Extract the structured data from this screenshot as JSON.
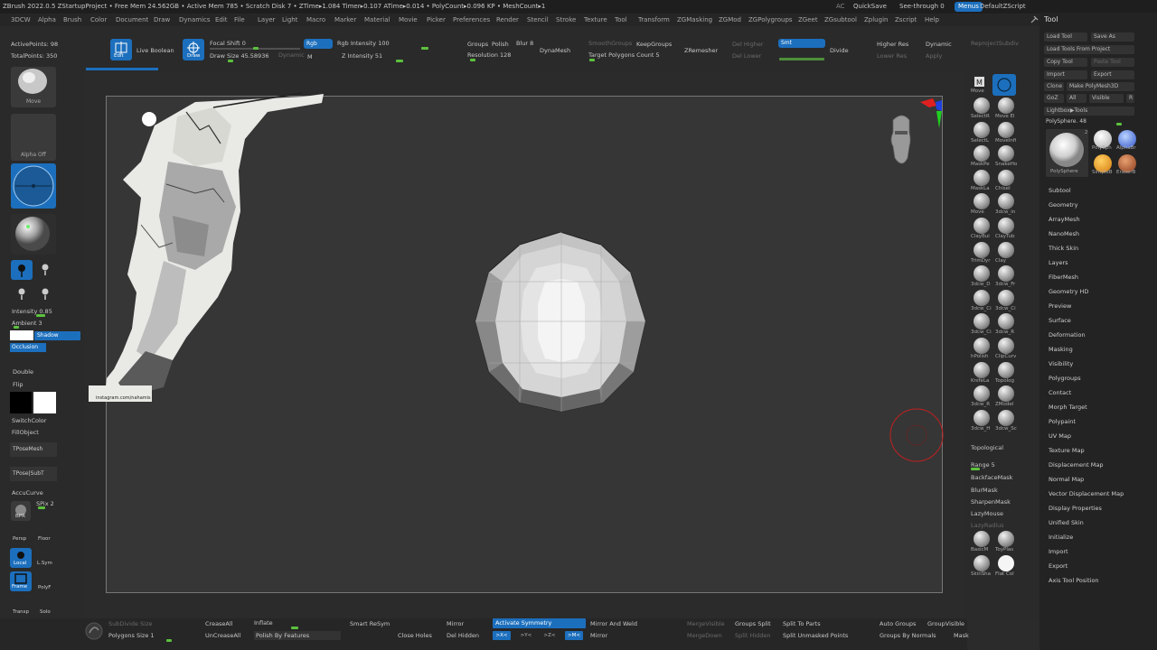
{
  "titlebar": {
    "text": "ZBrush 2022.0.5   ZStartupProject   • Free Mem 24.562GB • Active Mem 785 • Scratch Disk 7 • ZTime▸1.084 Timer▸0.107 ATime▸0.014 • PolyCount▸0.096 KP • MeshCount▸1",
    "ac": "AC",
    "quicksave": "QuickSave",
    "see_through": "See-through  0",
    "menus": "Menus",
    "default_script": "DefaultZScript"
  },
  "menubar": [
    "3DCW",
    "Alpha",
    "Brush",
    "Color",
    "Document",
    "Draw",
    "Dynamics",
    "Edit",
    "File",
    "Layer",
    "Light",
    "Macro",
    "Marker",
    "Material",
    "Movie",
    "Picker",
    "Preferences",
    "Render",
    "Stencil",
    "Stroke",
    "Texture",
    "Tool",
    "Transform",
    "ZGMasking",
    "ZGMod",
    "ZGPolygroups",
    "ZGeet",
    "ZGsubtool",
    "Zplugin",
    "Zscript",
    "Help"
  ],
  "topshelf": {
    "active_points": "ActivePoints: 98",
    "total_points": "TotalPoints: 350",
    "edit": "Edit",
    "live_boolean": "Live Boolean",
    "draw": "Draw",
    "focal_shift": "Focal Shift 0",
    "draw_size": "Draw Size 45.58936",
    "dynamic": "Dynamic",
    "rgb": "Rgb",
    "m": "M",
    "rgb_intensity": "Rgb Intensity 100",
    "z_intensity": "Z Intensity 51",
    "groups": "Groups",
    "polish": "Polish",
    "blur": "Blur 8",
    "resolution": "Resolution 128",
    "dynamesh": "DynaMesh",
    "smooth_groups": "SmoothGroups",
    "keep_groups": "KeepGroups",
    "target_polygons": "Target Polygons Count 5",
    "zremesher": "ZRemesher",
    "del_higher": "Del Higher",
    "del_lower": "Del Lower",
    "smt": "Smt",
    "divide": "Divide",
    "higher_res": "Higher Res",
    "lower_res": "Lower Res",
    "dynamic2": "Dynamic",
    "apply": "Apply",
    "reproject": "ReprojectSubdiv"
  },
  "leftshelf": {
    "move": "Move",
    "alpha_off": "Alpha Off",
    "intensity": "Intensity 0.85",
    "ambient": "Ambient 3",
    "shadow": "Shadow",
    "occlusion": "Occlusion",
    "double": "Double",
    "flip": "Flip",
    "switch_color": "SwitchColor",
    "fill_object": "FillObject",
    "tpose_mesh": "TPoseMesh",
    "tpose_subt": "TPose|SubT",
    "accucurve": "AccuCurve",
    "spix": "SPix 2",
    "bpr": "BPR",
    "persp": "Persp",
    "floor": "Floor",
    "local": "Local",
    "lsym": "L.Sym",
    "frame": "Frame",
    "polyf": "PolyF",
    "transp": "Transp",
    "solo": "Solo"
  },
  "bottomshelf": {
    "subdivide_size": "SubDivide Size",
    "polygons_size": "Polygons Size 1",
    "crease_all": "CreaseAll",
    "uncrease_all": "UnCreaseAll",
    "inflate": "Inflate",
    "polish_features": "Polish By Features",
    "smart_resym": "Smart ReSym",
    "close_holes": "Close Holes",
    "mirror": "Mirror",
    "del_hidden": "Del Hidden",
    "activate_symmetry": "Activate Symmetry",
    "x": ">X<",
    "y": ">Y<",
    "z": ">Z<",
    "m": ">M<",
    "mirror_weld": "Mirror And Weld",
    "mirror2": "Mirror",
    "merge_visible": "MergeVisible",
    "merge_down": "MergeDown",
    "groups_split": "Groups Split",
    "split_hidden": "Split Hidden",
    "split_to_parts": "Split To Parts",
    "split_unmasked": "Split Unmasked Points",
    "auto_groups": "Auto Groups",
    "groups_by_normals": "Groups By Normals",
    "group_visible": "GroupVisible",
    "mask": "Mask"
  },
  "reference": {
    "caption": "instagram.com/nahamis"
  },
  "rightshelf": {
    "move": "Move",
    "brushes": [
      "SelectR",
      "Move El",
      "SelectL",
      "MoveInfi",
      "MaskPe",
      "SnakeHo",
      "MaskLa",
      "Chisel",
      "Move",
      "3dcw_in",
      "ClayBui",
      "ClayTub",
      "TrimDyr",
      "Clay",
      "3dcw_D",
      "3dcw_Fr",
      "3dcw_Ci",
      "3dcw_Ci",
      "3dcw_Ci",
      "3dcw_R",
      "hPolish",
      "ClipCurv",
      "KnifeLa",
      "Topolog",
      "3dcw_R",
      "ZModel",
      "3dcw_H",
      "3dcw_Sc"
    ],
    "topological": "Topological",
    "range": "Range 5",
    "backface_mask": "BackfaceMask",
    "blur_mask": "BlurMask",
    "sharpen_mask": "SharpenMask",
    "lazy_mouse": "LazyMouse",
    "lazy_radius": "LazyRadius",
    "materials": [
      "BasicM",
      "ToyPlas",
      "SkinSha",
      "Flat Col"
    ]
  },
  "toolpalette": {
    "title": "Tool",
    "buttons": [
      "Load Tool",
      "Save As",
      "Load Tools From Project",
      "Copy Tool",
      "Paste Tool",
      "Import",
      "Export",
      "Clone",
      "Make PolyMesh3D",
      "GoZ",
      "All",
      "Visible",
      "R",
      "Lightbox▶Tools"
    ],
    "polysphere": "PolySphere. 48",
    "num_2": "2",
    "thumbs": [
      "PolySphere",
      "PolySph",
      "AlphaBr",
      "SimpleB",
      "EraserB"
    ],
    "items": [
      "Subtool",
      "Geometry",
      "ArrayMesh",
      "NanoMesh",
      "Thick Skin",
      "Layers",
      "FiberMesh",
      "Geometry HD",
      "Preview",
      "Surface",
      "Deformation",
      "Masking",
      "Visibility",
      "Polygroups",
      "Contact",
      "Morph Target",
      "Polypaint",
      "UV Map",
      "Texture Map",
      "Displacement Map",
      "Normal Map",
      "Vector Displacement Map",
      "Display Properties",
      "Unified Skin",
      "Initialize",
      "Import",
      "Export",
      "Axis Tool Position"
    ]
  },
  "colors": {
    "accent": "#1c6fbd",
    "slider": "#5cc13d",
    "viewport": "#363636"
  }
}
